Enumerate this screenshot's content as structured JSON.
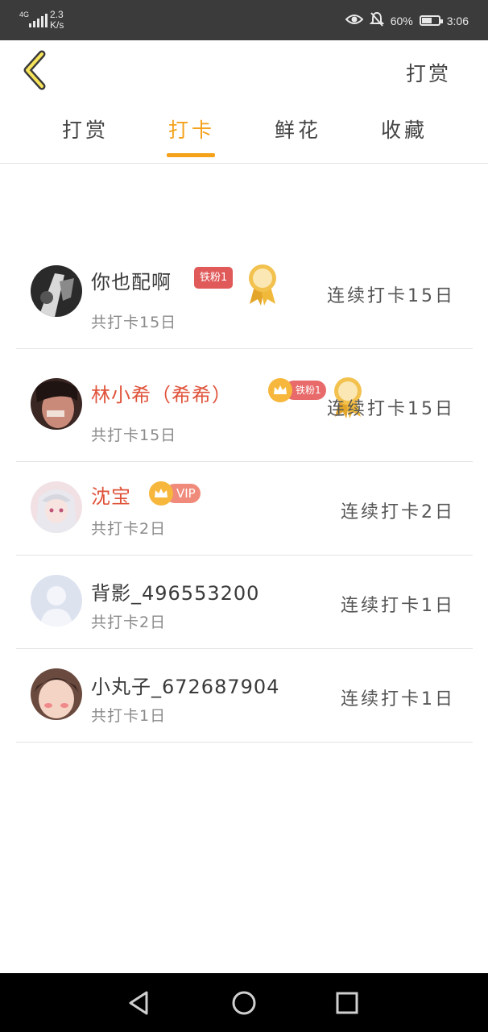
{
  "status_bar": {
    "network": "4G",
    "speed_value": "2.3",
    "speed_unit": "K/s",
    "battery": "60%",
    "battery_level": 0.6,
    "time": "3:06",
    "icons": [
      "signal-icon",
      "eye-icon",
      "bell-off-icon",
      "battery-icon"
    ]
  },
  "header": {
    "back_icon": "chevron-left-icon",
    "right_action": "打赏"
  },
  "tabs": [
    {
      "label": "打赏",
      "active": false
    },
    {
      "label": "打卡",
      "active": true
    },
    {
      "label": "鲜花",
      "active": false
    },
    {
      "label": "收藏",
      "active": false
    }
  ],
  "colors": {
    "accent": "#f5a21b",
    "highlight_name": "#e0533b",
    "fan_badge": "#e05a5a",
    "status_bar": "#3b3b3b"
  },
  "list": [
    {
      "name": "你也配啊",
      "badge": "铁粉1",
      "medal": true,
      "total": "共打卡15日",
      "streak": "连续打卡15日"
    },
    {
      "name": "林小希（希希）",
      "badge": "铁粉1",
      "crown": true,
      "medal": true,
      "total": "共打卡15日",
      "streak": "连续打卡15日"
    },
    {
      "name": "沈宝",
      "badge": "VIP",
      "crown": true,
      "total": "共打卡2日",
      "streak": "连续打卡2日"
    },
    {
      "name": "背影_496553200",
      "total": "共打卡2日",
      "streak": "连续打卡1日"
    },
    {
      "name": "小丸子_672687904",
      "total": "共打卡1日",
      "streak": "连续打卡1日"
    }
  ],
  "nav_bar": [
    "back-triangle-icon",
    "home-circle-icon",
    "recents-square-icon"
  ]
}
